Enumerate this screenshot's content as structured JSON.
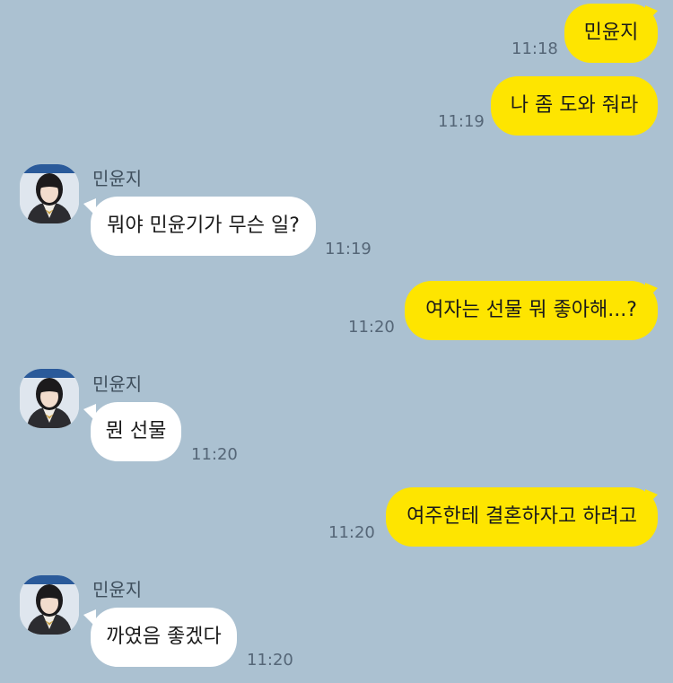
{
  "chat": {
    "sender_name": "민윤지",
    "messages": [
      {
        "from": "me",
        "text": "민윤지",
        "time": "11:18"
      },
      {
        "from": "me",
        "text": "나 좀 도와 줘라",
        "time": "11:19"
      },
      {
        "from": "other",
        "text": "뭐야 민윤기가 무슨 일?",
        "time": "11:19",
        "sender": "민윤지"
      },
      {
        "from": "me",
        "text": "여자는 선물 뭐 좋아해...?",
        "time": "11:20"
      },
      {
        "from": "other",
        "text": "뭔 선물",
        "time": "11:20",
        "sender": "민윤지"
      },
      {
        "from": "me",
        "text": "여주한테 결혼하자고 하려고",
        "time": "11:20"
      },
      {
        "from": "other",
        "text": "까였음 좋겠다",
        "time": "11:20",
        "sender": "민윤지"
      }
    ]
  },
  "colors": {
    "background": "#abc1d1",
    "my_bubble": "#fee500",
    "other_bubble": "#ffffff"
  }
}
